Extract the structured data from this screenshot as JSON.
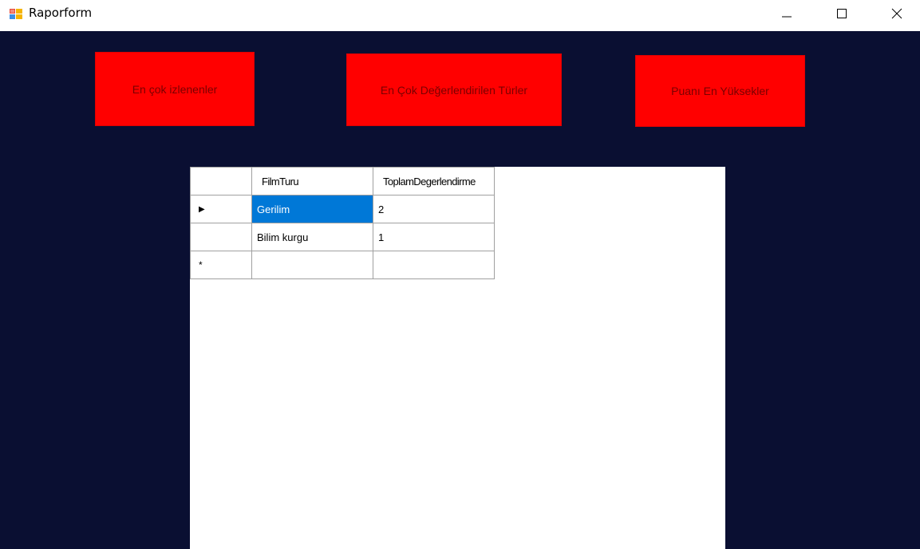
{
  "window": {
    "title": "Raporform",
    "icon": "winforms-app-icon",
    "controls": {
      "minimize": "minimize-icon",
      "maximize": "maximize-icon",
      "close": "close-icon"
    }
  },
  "colors": {
    "background": "#0a0f32",
    "button_bg": "#ff0000",
    "button_text": "#7a0000",
    "selection": "#0078d7"
  },
  "buttons": {
    "most_watched": "En çok izlenenler",
    "most_rated_genres": "En Çok Değerlendirilen Türler",
    "highest_rated": "Puanı En Yüksekler"
  },
  "grid": {
    "columns": [
      "FilmTuru",
      "ToplamDegerlendirme"
    ],
    "rows": [
      {
        "indicator": "▶",
        "film_turu": "Gerilim",
        "toplam": "2",
        "selected": true
      },
      {
        "indicator": "",
        "film_turu": "Bilim kurgu",
        "toplam": "1",
        "selected": false
      },
      {
        "indicator": "*",
        "film_turu": "",
        "toplam": "",
        "selected": false
      }
    ]
  }
}
